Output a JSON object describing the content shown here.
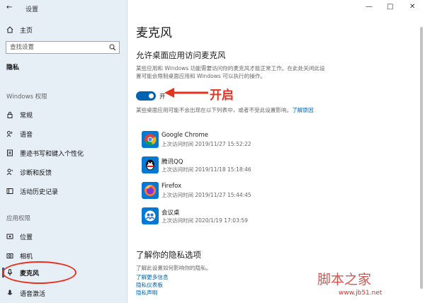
{
  "window": {
    "title": "设置"
  },
  "sidebar": {
    "home": "主页",
    "search_placeholder": "查找设置",
    "current": "隐私",
    "section_windows": "Windows 权限",
    "items_windows": [
      "常规",
      "语音",
      "墨迹书写和键入个性化",
      "诊断和反馈",
      "活动历史记录"
    ],
    "section_apps": "应用权限",
    "items_apps": [
      "位置",
      "相机",
      "麦克风",
      "语音激活"
    ]
  },
  "main": {
    "title": "麦克风",
    "section_title": "允许桌面应用访问麦克风",
    "description": "某些应用和 Windows 功能需要访问你的麦克风才能正常工作。在此处关闭此设置可能会限制桌面应用和 Windows 可以执行的操作。",
    "toggle_label": "开",
    "annotation": "开启",
    "note": "某些桌面应用可能不会出现在以下列表中，或者不受此设置影响。",
    "note_link": "了解原因",
    "apps": [
      {
        "name": "Google Chrome",
        "time": "上次访问时间 2019/11/27 15:52:22",
        "icon": "chrome-icon"
      },
      {
        "name": "腾讯QQ",
        "time": "上次访问时间 2019/11/18 15:18:46",
        "icon": "qq-icon"
      },
      {
        "name": "Firefox",
        "time": "上次访问时间 2019/11/27 15:44:45",
        "icon": "firefox-icon"
      },
      {
        "name": "会议桌",
        "time": "上次访问时间 2020/1/19 17:03:59",
        "icon": "meeting-icon"
      }
    ],
    "privacy_title": "了解你的隐私选项",
    "privacy_desc": "了解此设置如何影响你的隐私。",
    "privacy_links": [
      "了解更多信息",
      "隐私仪表板",
      "隐私声明"
    ]
  },
  "watermark": {
    "text": "脚本之家",
    "url": "www.jb51.net"
  },
  "colors": {
    "accent": "#0063b1",
    "annotation_red": "#e8301f"
  }
}
